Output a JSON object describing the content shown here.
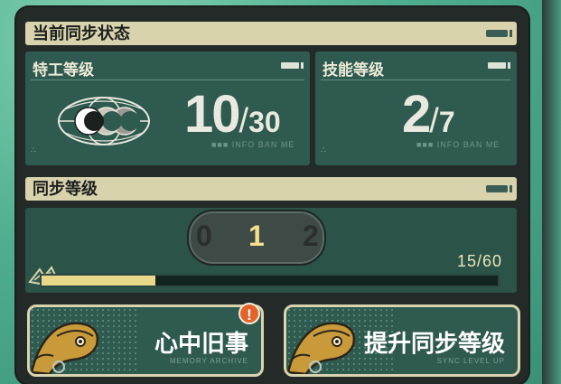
{
  "current_sync": {
    "header": "当前同步状态"
  },
  "agent_level": {
    "title": "特工等级",
    "value": "10",
    "slash": "/",
    "max": "30",
    "sub_caption": "■■■ INFO BAN ME"
  },
  "skill_level": {
    "title": "技能等级",
    "value": "2",
    "slash": "/",
    "max": "7",
    "sub_caption": "■■■ INFO BAN ME"
  },
  "sync_level": {
    "header": "同步等级",
    "counter": {
      "prev": "0",
      "current": "1",
      "next": "2"
    },
    "progress_text": "15/60",
    "progress_fraction": 0.25
  },
  "buttons": {
    "memories": {
      "label": "心中旧事",
      "caption": "MEMORY ARCHIVE"
    },
    "upgrade": {
      "label": "提升同步等级",
      "caption": "SYNC LEVEL UP"
    }
  },
  "notification": {
    "symbol": "!"
  },
  "colors": {
    "panel": "#232a28",
    "card": "#2f5a4f",
    "header": "#d8d3ad",
    "progress": "#e8d98a",
    "badge": "#e2642b"
  },
  "icons": {
    "rank_emblem": "crescent-moons-icon",
    "mascot": "otter-mascot-icon"
  }
}
